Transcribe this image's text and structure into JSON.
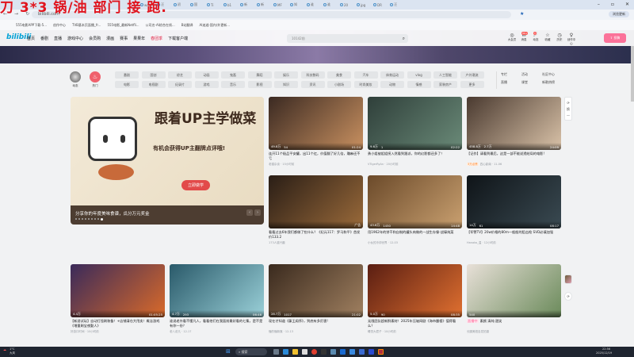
{
  "overlay_text": "刀 3*3 锅/油 部门 接 跑.",
  "browser": {
    "tabs": [
      "wa",
      "汪",
      "初",
      "国",
      "Ti",
      "b1",
      "新",
      "新",
      "MF",
      "知",
      "谁",
      "谁",
      "20",
      "jpg",
      "DR",
      "汪"
    ],
    "url": "bilibili.com",
    "update_label": "浏览更新",
    "bookmarks": [
      "555电影APP下载-5...",
      "创作中心",
      "TVB基本页面播_fr...",
      "555电影_最新Netfli...",
      "公司名-AI综合在线...",
      "B站翻译",
      "AI迪迦-国内/外更新..."
    ]
  },
  "header": {
    "logo": "bilibili",
    "nav": [
      "首页",
      "番剧",
      "直播",
      "游戏中心",
      "会员购",
      "漫画",
      "赛事",
      "果果年",
      "春团季",
      "下载客户端"
    ],
    "search_placeholder": "10142前",
    "right": [
      "大会员",
      "消息",
      "动态",
      "收藏",
      "历史",
      "创作中心"
    ],
    "msg_badge": "99+",
    "dyn_badge": "1",
    "upload_label": "投稿"
  },
  "channels": {
    "user": "动态",
    "hot": "热门",
    "cats": [
      "番剧",
      "国创",
      "综艺",
      "动画",
      "鬼畜",
      "舞蹈",
      "娱乐",
      "科技数码",
      "美食",
      "汽车",
      "体育运动",
      "vlog",
      "人工智能",
      "户外潮流",
      "电影",
      "电视剧",
      "纪录片",
      "游戏",
      "音乐",
      "影视",
      "知识",
      "资讯",
      "小剧场",
      "时尚美妆",
      "动物",
      "情感",
      "家装房产",
      "更多"
    ],
    "extra": [
      "专栏",
      "活动",
      "社区中心",
      "直播",
      "课堂",
      "新歌热榜"
    ]
  },
  "carousel": {
    "title": "跟着UP主学做菜",
    "subtitle": "有机会获得UP主翻牌点评哦!",
    "button": "立即做学",
    "caption": "分享你的年度美味食谱，瓜分万元奖金",
    "slides": 9,
    "active": 9
  },
  "cards": [
    {
      "title": "连开11个极品平安罐，出11个红，价值翻了好几倍，赚麻还不亏",
      "author": "老猫杂谈",
      "date": "15小时前",
      "views": "49.8万",
      "danmaku": "54",
      "dur": "01:24",
      "c": [
        "#3b2a22",
        "#c89060"
      ]
    },
    {
      "title": "勇小姐被姐姐拐入然看到跟派，你的幻影都还多了！",
      "author": "VTigerRyAn",
      "date": "20小时前",
      "views": "9.6万",
      "danmaku": "1",
      "dur": "02:22",
      "c": [
        "#2f3f3a",
        "#6a8a78"
      ]
    },
    {
      "title": "【记作】请看到最后，这是一部不能说透结局的电影!",
      "author": "四心影南",
      "date": "11-06",
      "badge": "3万点赞",
      "views": "458.8万",
      "danmaku": "2.7万",
      "dur": "24:09",
      "c": [
        "#4a3a30",
        "#d9c2a8"
      ]
    },
    {
      "title": "看看过去6年我们都做了些什么？《纪元117：罗马和平》首发价133.2",
      "author": "173人感兴趣",
      "date": "",
      "views": "",
      "danmaku": "",
      "dur": "广告",
      "c": [
        "#2a1e16",
        "#9a6a3a"
      ]
    },
    {
      "title": "用1962年的饼干和自制的罐头肉做的一战生存餐-战壕炖菜",
      "author": "小伙的冷却世界",
      "date": "12-03",
      "views": "43.6万",
      "danmaku": "1450",
      "dur": "14:48",
      "c": [
        "#6b4a2a",
        "#c9a070"
      ]
    },
    {
      "title": "【军警TV】20w价格的80m一般般的狙击枪 SVD必填加强",
      "author": "Hanako_温",
      "date": "12小时前",
      "views": "14万",
      "danmaku": "61",
      "dur": "08:17",
      "c": [
        "#0f1418",
        "#3a4a52"
      ]
    },
    {
      "title": "【新游试玩】自动打怪刷装备！+店铺清仓大甩卖！概念游戏《增量刷宝夜勤人》",
      "author": "好游口时间",
      "date": "10小时前",
      "views": "4.4万",
      "danmaku": "",
      "dur": "01:05:25",
      "c": [
        "#3a2a5a",
        "#d96a2a"
      ]
    },
    {
      "title": "谁说老外看不懂凡人，看看他们在我面前最好看的七集，是不是有你一份？",
      "author": "老八说凡",
      "date": "12-17",
      "views": "4.7万",
      "danmaku": "293",
      "dur": "06:46",
      "c": [
        "#2a5a6a",
        "#9ad0d8"
      ]
    },
    {
      "title": "现在才知道《藤王阁序》，到底有多厉害!",
      "author": "懂的懂新媒",
      "date": "12-13",
      "views": "28.7万",
      "danmaku": "1017",
      "dur": "21:02",
      "c": [
        "#3a2a1e",
        "#a08060"
      ]
    },
    {
      "title": "无限团队超新鲜素材！2025年压轴网剧《海市蜃楼》值得看么？",
      "author": "睡觉大君子",
      "date": "10小时前",
      "views": "5.0万",
      "danmaku": "90",
      "dur": "08:35",
      "c": [
        "#5a1e12",
        "#e07030"
      ]
    },
    {
      "title": "素颜 清纯 甜笑",
      "author": "长腿美妞自发拍摄",
      "date": "",
      "live": "直播中",
      "views": "540",
      "danmaku": "",
      "dur": "",
      "c": [
        "#e8e0d8",
        "#6a8a5a"
      ]
    }
  ],
  "side": {
    "refresh": "换一换"
  },
  "taskbar": {
    "weather": "大风",
    "weather_sub": "1°C",
    "search": "搜索",
    "time": "22:56",
    "date": "2025/12/19"
  }
}
